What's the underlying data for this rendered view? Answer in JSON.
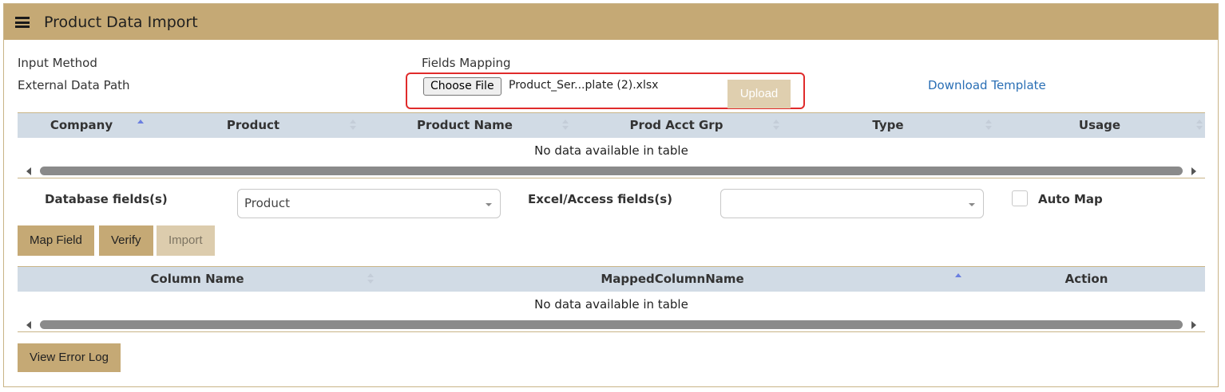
{
  "header": {
    "title": "Product Data Import",
    "menu_icon": "hamburger-menu-icon"
  },
  "form": {
    "input_method_label": "Input Method",
    "external_path_label": "External Data Path",
    "fields_mapping_label": "Fields Mapping",
    "choose_file_label": "Choose File",
    "file_name": "Product_Ser...plate (2).xlsx",
    "upload_label": "Upload",
    "download_template_label": "Download Template"
  },
  "products_table": {
    "columns": [
      "Company",
      "Product",
      "Product Name",
      "Prod Acct Grp",
      "Type",
      "Usage"
    ],
    "sorted_column": "Company",
    "sort_direction": "ascending",
    "empty_message": "No data available in table"
  },
  "mapping": {
    "database_fields_label": "Database fields(s)",
    "database_field_value": "Product",
    "excel_fields_label": "Excel/Access fields(s)",
    "excel_field_value": "",
    "auto_map_label": "Auto Map",
    "auto_map_checked": false
  },
  "actions": {
    "map_field_label": "Map Field",
    "verify_label": "Verify",
    "import_label": "Import"
  },
  "mapped_table": {
    "columns": [
      "Column Name",
      "MappedColumnName",
      "Action"
    ],
    "sorted_column": "MappedColumnName",
    "sort_direction": "ascending",
    "empty_message": "No data available in table"
  },
  "footer": {
    "view_error_log_label": "View Error Log"
  },
  "colors": {
    "accent": "#c5a975",
    "accent_disabled": "#dcccad",
    "table_header": "#d1dbe5",
    "link": "#2a6fb5",
    "highlight_border": "#e02b2b"
  }
}
